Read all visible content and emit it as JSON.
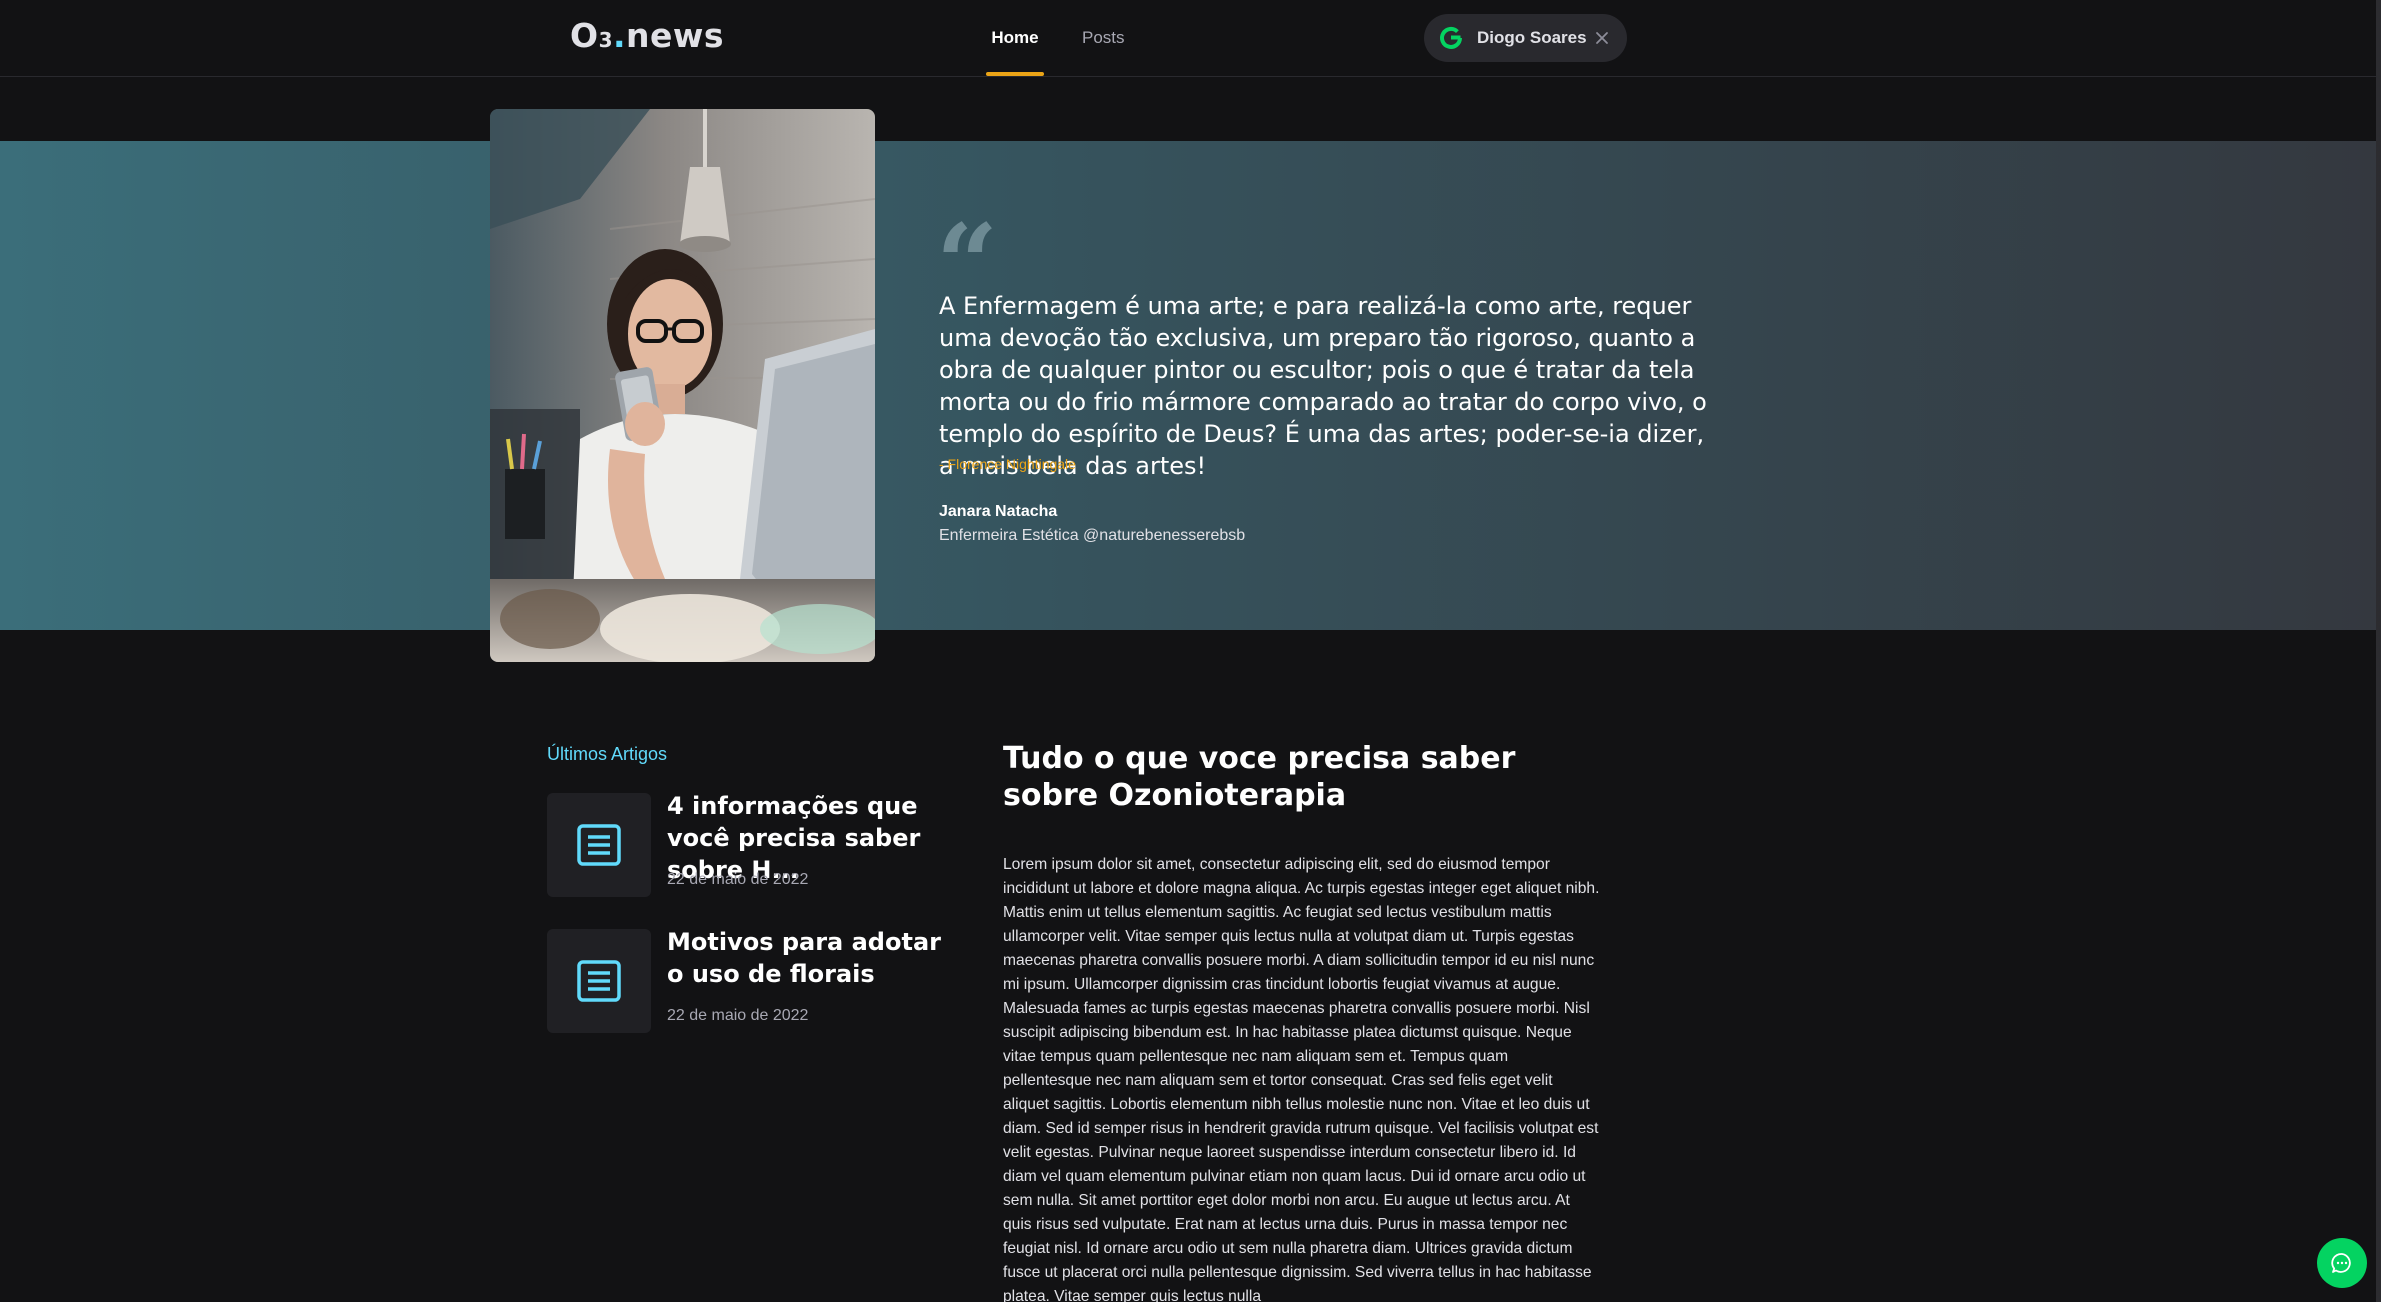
{
  "header": {
    "logo": "O",
    "logo_sub": "3",
    "logo_dot": ".",
    "logo_suffix": "news",
    "nav": {
      "home": "Home",
      "posts": "Posts"
    },
    "user_name": "Diogo Soares"
  },
  "banner": {
    "quote_mark": "“",
    "quote": "A Enfermagem é uma arte; e para realizá-la como arte, requer uma devoção tão exclusiva, um preparo tão rigoroso, quanto a obra de qualquer pintor ou escultor; pois o que é tratar da tela morta ou do frio mármore comparado ao tratar do corpo vivo, o templo do espírito de Deus? É uma das artes; poder-se-ia dizer, a mais bela das artes!",
    "quote_author": "- Florence Nightingale",
    "person_name": "Janara Natacha",
    "person_role": "Enfermeira Estética @naturebenesserebsb"
  },
  "latest": {
    "title": "Últimos Artigos",
    "articles": [
      {
        "title": "4 informações que você precisa saber sobre H...",
        "date": "22 de maio de 2022"
      },
      {
        "title": "Motivos para adotar o uso de florais",
        "date": "22 de maio de 2022"
      }
    ]
  },
  "main": {
    "title": "Tudo o que voce precisa saber sobre Ozonioterapia",
    "body": "Lorem ipsum dolor sit amet, consectetur adipiscing elit, sed do eiusmod tempor incididunt ut labore et dolore magna aliqua. Ac turpis egestas integer eget aliquet nibh. Mattis enim ut tellus elementum sagittis. Ac feugiat sed lectus vestibulum mattis ullamcorper velit. Vitae semper quis lectus nulla at volutpat diam ut. Turpis egestas maecenas pharetra convallis posuere morbi. A diam sollicitudin tempor id eu nisl nunc mi ipsum. Ullamcorper dignissim cras tincidunt lobortis feugiat vivamus at augue. Malesuada fames ac turpis egestas maecenas pharetra convallis posuere morbi. Nisl suscipit adipiscing bibendum est. In hac habitasse platea dictumst quisque. Neque vitae tempus quam pellentesque nec nam aliquam sem et. Tempus quam pellentesque nec nam aliquam sem et tortor consequat. Cras sed felis eget velit aliquet sagittis. Lobortis elementum nibh tellus molestie nunc non. Vitae et leo duis ut diam. Sed id semper risus in hendrerit gravida rutrum quisque. Vel facilisis volutpat est velit egestas. Pulvinar neque laoreet suspendisse interdum consectetur libero id. Id diam vel quam elementum pulvinar etiam non quam lacus. Dui id ornare arcu odio ut sem nulla. Sit amet porttitor eget dolor morbi non arcu. Eu augue ut lectus arcu. At quis risus sed vulputate. Erat nam at lectus urna duis. Purus in massa tempor nec feugiat nisl. Id ornare arcu odio ut sem nulla pharetra diam. Ultrices gravida dictum fusce ut placerat orci nulla pellentesque dignissim. Sed viverra tellus in hac habitasse platea. Vitae semper quis lectus nulla"
  },
  "colors": {
    "accent_yellow": "#eba417",
    "accent_cyan": "#61dafb",
    "chat_green": "#04d361",
    "google_green": "#04d361"
  },
  "icons": {
    "user": "google-g-icon",
    "close": "close-icon",
    "article": "document-lines-icon",
    "chat": "chat-bubble-icon"
  }
}
